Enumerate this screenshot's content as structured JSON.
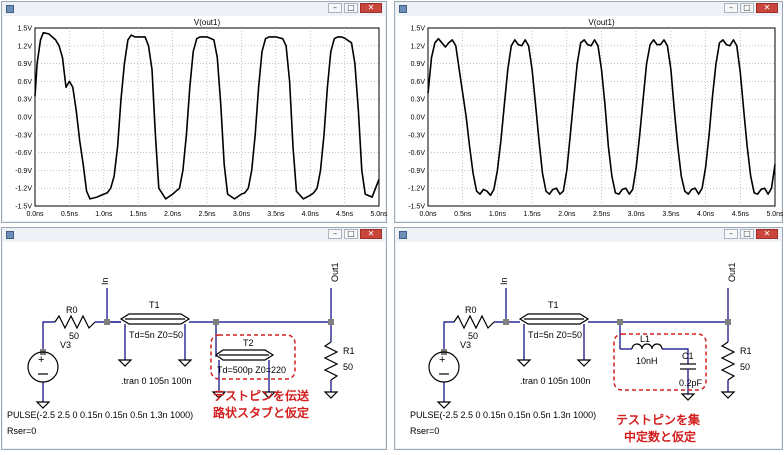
{
  "plots": [
    {
      "title": "V(out1)",
      "y_ticks": [
        "1.5V",
        "1.2V",
        "0.9V",
        "0.6V",
        "0.3V",
        "0.0V",
        "-0.3V",
        "-0.6V",
        "-0.9V",
        "-1.2V",
        "-1.5V"
      ],
      "x_ticks": [
        "0.0ns",
        "0.5ns",
        "1.0ns",
        "1.5ns",
        "2.0ns",
        "2.5ns",
        "3.0ns",
        "3.5ns",
        "4.0ns",
        "4.5ns",
        "5.0ns"
      ]
    },
    {
      "title": "V(out1)",
      "y_ticks": [
        "1.5V",
        "1.2V",
        "0.9V",
        "0.6V",
        "0.3V",
        "0.0V",
        "-0.3V",
        "-0.6V",
        "-0.9V",
        "-1.2V",
        "-1.5V"
      ],
      "x_ticks": [
        "0.0ns",
        "0.5ns",
        "1.0ns",
        "1.5ns",
        "2.0ns",
        "2.5ns",
        "3.0ns",
        "3.5ns",
        "4.0ns",
        "4.5ns",
        "5.0ns"
      ]
    }
  ],
  "chart_data": [
    {
      "type": "line",
      "title": "V(out1)",
      "xlim": [
        0,
        5
      ],
      "ylim": [
        -1.5,
        1.5
      ],
      "x": [
        0.0,
        0.03,
        0.08,
        0.12,
        0.2,
        0.25,
        0.3,
        0.35,
        0.4,
        0.45,
        0.5,
        0.55,
        0.6,
        0.65,
        0.7,
        0.75,
        0.8,
        0.9,
        1.0,
        1.05,
        1.1,
        1.15,
        1.2,
        1.25,
        1.3,
        1.35,
        1.4,
        1.45,
        1.5,
        1.6,
        1.65,
        1.7,
        1.75,
        1.8,
        1.9,
        2.0,
        2.05,
        2.1,
        2.15,
        2.2,
        2.25,
        2.3,
        2.35,
        2.4,
        2.45,
        2.5,
        2.6,
        2.65,
        2.7,
        2.75,
        2.8,
        2.9,
        3.0,
        3.05,
        3.1,
        3.15,
        3.2,
        3.25,
        3.3,
        3.35,
        3.4,
        3.45,
        3.5,
        3.6,
        3.65,
        3.7,
        3.75,
        3.8,
        3.9,
        4.0,
        4.05,
        4.1,
        4.15,
        4.2,
        4.25,
        4.3,
        4.35,
        4.4,
        4.45,
        4.5,
        4.6,
        4.65,
        4.7,
        4.75,
        4.8,
        4.9,
        5.0
      ],
      "y": [
        0.35,
        0.9,
        1.3,
        1.42,
        1.4,
        1.35,
        1.3,
        1.2,
        1.0,
        0.5,
        0.6,
        0.5,
        0.1,
        -0.4,
        -0.8,
        -1.25,
        -1.38,
        -1.35,
        -1.3,
        -1.28,
        -1.2,
        -1.0,
        -0.5,
        0.3,
        0.9,
        1.3,
        1.38,
        1.35,
        1.35,
        1.35,
        1.2,
        0.8,
        -0.3,
        -1.2,
        -1.38,
        -1.3,
        -1.25,
        -1.2,
        -0.9,
        -0.3,
        0.5,
        1.1,
        1.32,
        1.35,
        1.35,
        1.35,
        1.3,
        1.0,
        0.2,
        -0.8,
        -1.3,
        -1.38,
        -1.3,
        -1.28,
        -1.2,
        -0.9,
        -0.3,
        0.5,
        1.1,
        1.32,
        1.35,
        1.35,
        1.35,
        1.32,
        1.2,
        0.6,
        -0.5,
        -1.25,
        -1.38,
        -1.32,
        -1.28,
        -1.2,
        -0.9,
        -0.3,
        0.5,
        1.1,
        1.32,
        1.35,
        1.35,
        1.33,
        1.25,
        0.9,
        0.1,
        -0.9,
        -1.3,
        -1.35,
        -1.05
      ]
    },
    {
      "type": "line",
      "title": "V(out1)",
      "xlim": [
        0,
        5
      ],
      "ylim": [
        -1.5,
        1.5
      ],
      "x": [
        0.0,
        0.05,
        0.1,
        0.15,
        0.2,
        0.25,
        0.3,
        0.35,
        0.4,
        0.45,
        0.5,
        0.55,
        0.6,
        0.65,
        0.7,
        0.75,
        0.8,
        0.85,
        0.9,
        0.95,
        1.0,
        1.05,
        1.1,
        1.15,
        1.2,
        1.25,
        1.3,
        1.35,
        1.4,
        1.45,
        1.5,
        1.55,
        1.6,
        1.65,
        1.7,
        1.75,
        1.8,
        1.85,
        1.9,
        1.95,
        2.0,
        2.05,
        2.1,
        2.15,
        2.2,
        2.25,
        2.3,
        2.35,
        2.4,
        2.45,
        2.5,
        2.55,
        2.6,
        2.65,
        2.7,
        2.75,
        2.8,
        2.85,
        2.9,
        2.95,
        3.0,
        3.05,
        3.1,
        3.15,
        3.2,
        3.25,
        3.3,
        3.35,
        3.4,
        3.45,
        3.5,
        3.55,
        3.6,
        3.65,
        3.7,
        3.75,
        3.8,
        3.85,
        3.9,
        3.95,
        4.0,
        4.05,
        4.1,
        4.15,
        4.2,
        4.25,
        4.3,
        4.35,
        4.4,
        4.45,
        4.5,
        4.55,
        4.6,
        4.65,
        4.7,
        4.75,
        4.8,
        4.85,
        4.9,
        4.95,
        5.0
      ],
      "y": [
        0.4,
        1.0,
        1.25,
        1.32,
        1.25,
        1.18,
        1.25,
        1.3,
        1.2,
        0.8,
        0.4,
        0.0,
        -0.5,
        -0.95,
        -1.25,
        -1.3,
        -1.22,
        -1.25,
        -1.32,
        -1.22,
        -0.9,
        -0.4,
        0.2,
        0.8,
        1.2,
        1.3,
        1.22,
        1.2,
        1.3,
        1.2,
        0.8,
        0.2,
        -0.4,
        -0.95,
        -1.25,
        -1.3,
        -1.22,
        -1.2,
        -1.3,
        -1.25,
        -0.9,
        -0.3,
        0.3,
        0.9,
        1.25,
        1.3,
        1.22,
        1.2,
        1.3,
        1.2,
        0.8,
        0.2,
        -0.5,
        -1.0,
        -1.28,
        -1.3,
        -1.22,
        -1.2,
        -1.3,
        -1.22,
        -0.85,
        -0.3,
        0.3,
        0.9,
        1.22,
        1.3,
        1.22,
        1.22,
        1.3,
        1.2,
        0.8,
        0.1,
        -0.5,
        -1.0,
        -1.25,
        -1.3,
        -1.22,
        -1.2,
        -1.3,
        -1.2,
        -0.85,
        -0.3,
        0.35,
        0.9,
        1.25,
        1.3,
        1.22,
        1.2,
        1.3,
        1.2,
        0.75,
        0.1,
        -0.5,
        -1.0,
        -1.28,
        -1.3,
        -1.22,
        -1.2,
        -1.3,
        -1.2,
        -0.8
      ]
    }
  ],
  "schematics": [
    {
      "r0_label": "R0",
      "r0_value": "50",
      "v3_label": "V3",
      "in_label": "In",
      "t1_label": "T1",
      "t1_params": "Td=5n Z0=50",
      "t2_label": "T2",
      "t2_params": "Td=500p Z0=220",
      "out_label": "Out1",
      "r1_label": "R1",
      "r1_value": "50",
      "tran": ".tran 0 105n 100n",
      "pulse": "PULSE(-2.5 2.5 0 0.15n 0.15n 0.5n 1.3n 1000)",
      "rser": "Rser=0",
      "note_line1": "テストピンを伝送",
      "note_line2": "路状スタブと仮定"
    },
    {
      "r0_label": "R0",
      "r0_value": "50",
      "v3_label": "V3",
      "in_label": "In",
      "t1_label": "T1",
      "t1_params": "Td=5n Z0=50",
      "l1_label": "L1",
      "l1_value": "10nH",
      "c1_label": "C1",
      "c1_value": "0.2pF",
      "out_label": "Out1",
      "r1_label": "R1",
      "r1_value": "50",
      "tran": ".tran 0 105n 100n",
      "pulse": "PULSE(-2.5 2.5 0 0.15n 0.15n 0.5n 1.3n 1000)",
      "rser": "Rser=0",
      "note_line1": "テストピンを集",
      "note_line2": "中定数と仮定"
    }
  ],
  "window_buttons": {
    "minimize": "–",
    "maximize": "□",
    "close": "✕"
  },
  "colors": {
    "trace": "#000000",
    "grid": "#a0a0a0",
    "annotation": "#d21e1e",
    "wire": "#000080"
  }
}
